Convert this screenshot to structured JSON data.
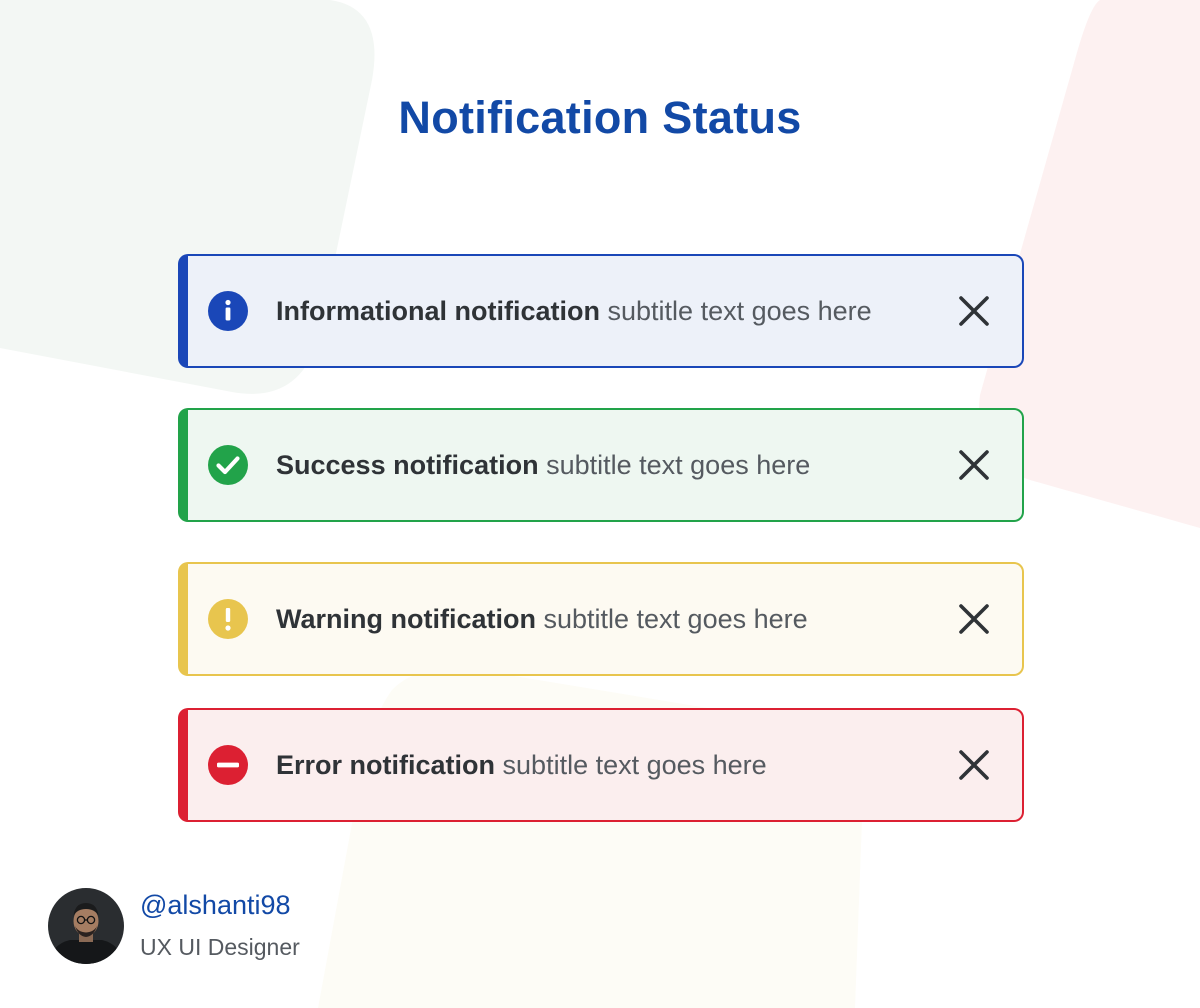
{
  "page": {
    "title": "Notification Status"
  },
  "notifications": [
    {
      "type": "info",
      "title": "Informational notification",
      "subtitle": "subtitle text goes here",
      "icon": "info-icon",
      "accent": "#1a47b8",
      "background": "#edf1f9"
    },
    {
      "type": "success",
      "title": "Success notification",
      "subtitle": "subtitle text goes here",
      "icon": "check-circle-icon",
      "accent": "#22a34a",
      "background": "#eef7f1"
    },
    {
      "type": "warning",
      "title": "Warning notification",
      "subtitle": "subtitle text goes here",
      "icon": "exclamation-icon",
      "accent": "#e8c54e",
      "background": "#fdfaf2"
    },
    {
      "type": "error",
      "title": "Error notification",
      "subtitle": "subtitle text goes here",
      "icon": "minus-circle-icon",
      "accent": "#dc2032",
      "background": "#fbeeee"
    }
  ],
  "close_icon": "close-icon",
  "author": {
    "handle": "@alshanti98",
    "role": "UX UI Designer",
    "avatar": "avatar-photo"
  },
  "colors": {
    "title": "#1249a6",
    "text_strong": "#2f3337",
    "text_muted": "#555a60",
    "bg_green_blob": "#f3f7f4",
    "bg_pink_blob": "#fdf1f1",
    "bg_cream_blob": "#fdfcf6"
  }
}
